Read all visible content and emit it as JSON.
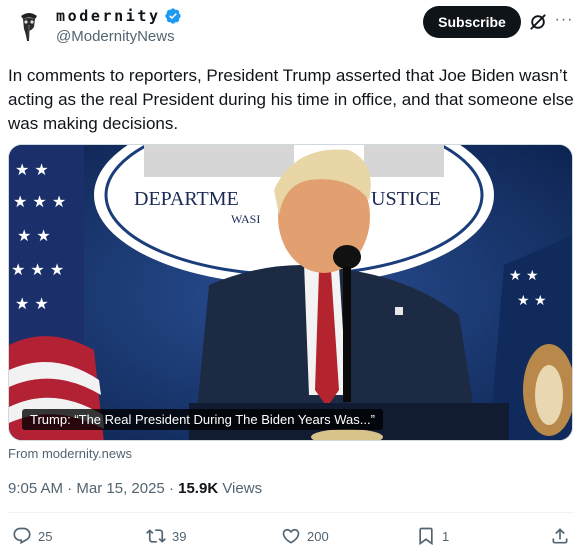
{
  "author": {
    "display_name": "modernity",
    "handle": "@ModernityNews",
    "verified": true,
    "avatar_icon": "plague-doctor-logo-icon"
  },
  "header": {
    "subscribe_label": "Subscribe",
    "grok_icon": "grok-icon",
    "more_label": "···"
  },
  "tweet": {
    "text": "In comments to reporters, President Trump asserted that Joe Biden wasn’t acting as the real President during his time in office, and that someone else was making decisions."
  },
  "media": {
    "seal_text_left": "DEPARTME",
    "seal_text_right": "USTICE",
    "seal_text_sub": "WASI",
    "caption": "Trump: “The Real President During The Biden Years Was...”",
    "source": "From modernity.news"
  },
  "meta": {
    "time": "9:05 AM",
    "separator": "·",
    "date": "Mar 15, 2025",
    "views_count": "15.9K",
    "views_label": "Views"
  },
  "actions": {
    "replies": "25",
    "reposts": "39",
    "likes": "200",
    "bookmarks": "1"
  },
  "colors": {
    "text": "#0f1419",
    "secondary": "#536471",
    "verified": "#1d9bf0",
    "backdrop": "#1a3d7c"
  }
}
